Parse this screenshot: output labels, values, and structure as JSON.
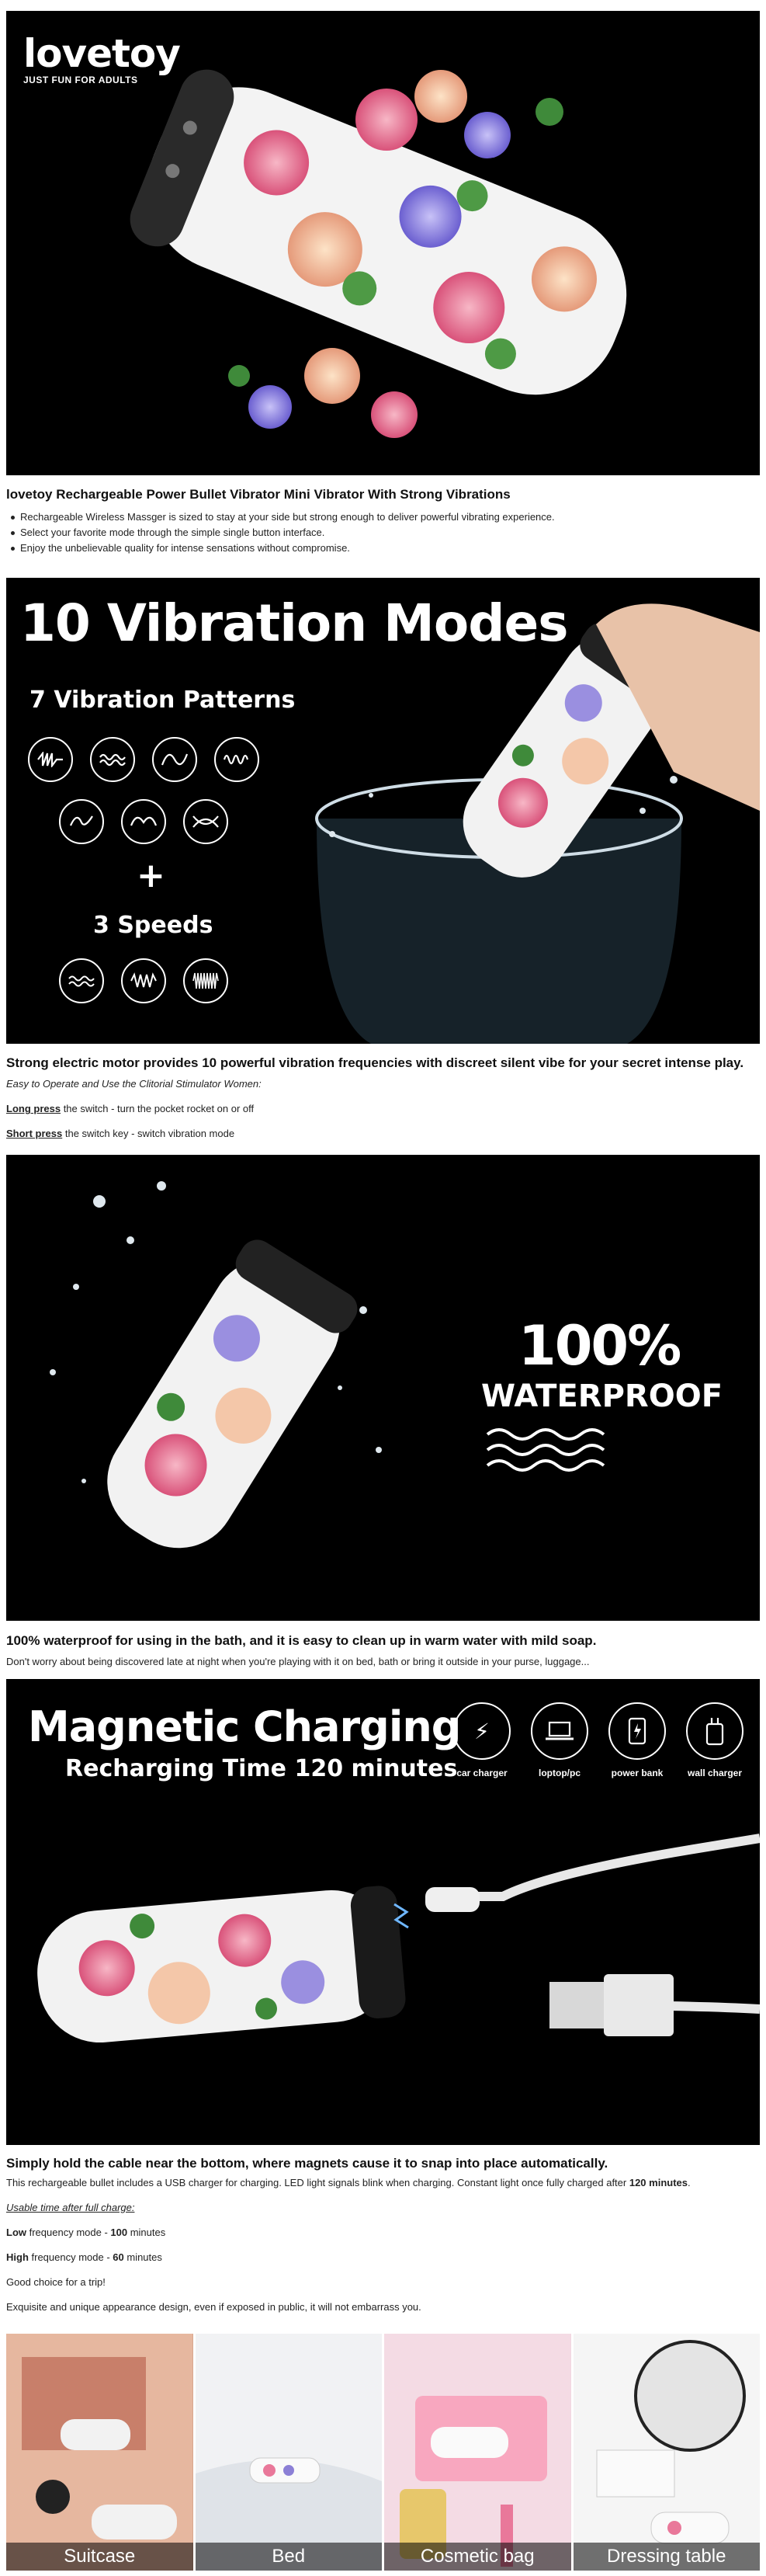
{
  "banner1": {
    "logo_word": "lovetoy",
    "logo_tag": "JUST FUN FOR ADULTS"
  },
  "section1": {
    "title": "lovetoy Rechargeable Power Bullet Vibrator Mini Vibrator With Strong Vibrations",
    "bullets": [
      "Rechargeable Wireless Massger is sized to stay at your side but strong enough to deliver powerful vibrating experience.",
      "Select your favorite mode through the simple single button interface.",
      "Enjoy the unbelievable quality for intense sensations without compromise."
    ]
  },
  "banner2": {
    "headline": "10 Vibration Modes",
    "patterns_label": "7 Vibration Patterns",
    "plus": "+",
    "speeds_label": "3 Speeds"
  },
  "section2": {
    "title": "Strong electric motor provides 10 powerful vibration frequencies with discreet silent vibe for your secret intense play.",
    "subtitle": "Easy to Operate and Use the Clitorial Stimulator Women:",
    "long_press_label": "Long press",
    "long_press_text": " the switch - turn the pocket rocket on or off",
    "short_press_label": "Short press",
    "short_press_text": " the switch key - switch vibration mode"
  },
  "banner3": {
    "big": "100%",
    "word": "WATERPROOF"
  },
  "section3": {
    "title": "100% waterproof for using in the bath, and it is easy to clean up in warm water with mild soap.",
    "text": "Don't worry about being discovered late at night when you're playing with it on bed, bath or bring it outside in your purse, luggage..."
  },
  "banner4": {
    "headline": "Magnetic Charging",
    "subline": "Recharging Time 120 minutes",
    "chargers": [
      {
        "icon": "car-charger-icon",
        "label": "car charger"
      },
      {
        "icon": "laptop-icon",
        "label": "loptop/pc"
      },
      {
        "icon": "power-bank-icon",
        "label": "power bank"
      },
      {
        "icon": "wall-charger-icon",
        "label": "wall charger"
      }
    ]
  },
  "section4": {
    "title": "Simply hold the cable near the bottom, where magnets cause it to snap into place automatically.",
    "text_a": "This rechargeable bullet includes a USB charger for charging. LED light signals blink when charging. Constant light once fully charged after ",
    "text_b": "120 minutes",
    "text_c": ".",
    "usable": "Usable time after full charge:",
    "low_a": "Low",
    "low_b": " frequency mode - ",
    "low_c": "100",
    "low_d": " minutes",
    "high_a": "High",
    "high_b": " frequency mode - ",
    "high_c": "60",
    "high_d": " minutes",
    "trip": "Good choice for a trip!",
    "exq": "Exquisite and unique appearance design, even if exposed in public, it will not embarrass you."
  },
  "gallery": [
    "Suitcase",
    "Bed",
    "Cosmetic bag",
    "Dressing table"
  ],
  "colors": {
    "banner_bg": "#000000",
    "rose_pink": "#e9789a",
    "leaf_green": "#3f8a3a",
    "lavender": "#8c80d6"
  }
}
